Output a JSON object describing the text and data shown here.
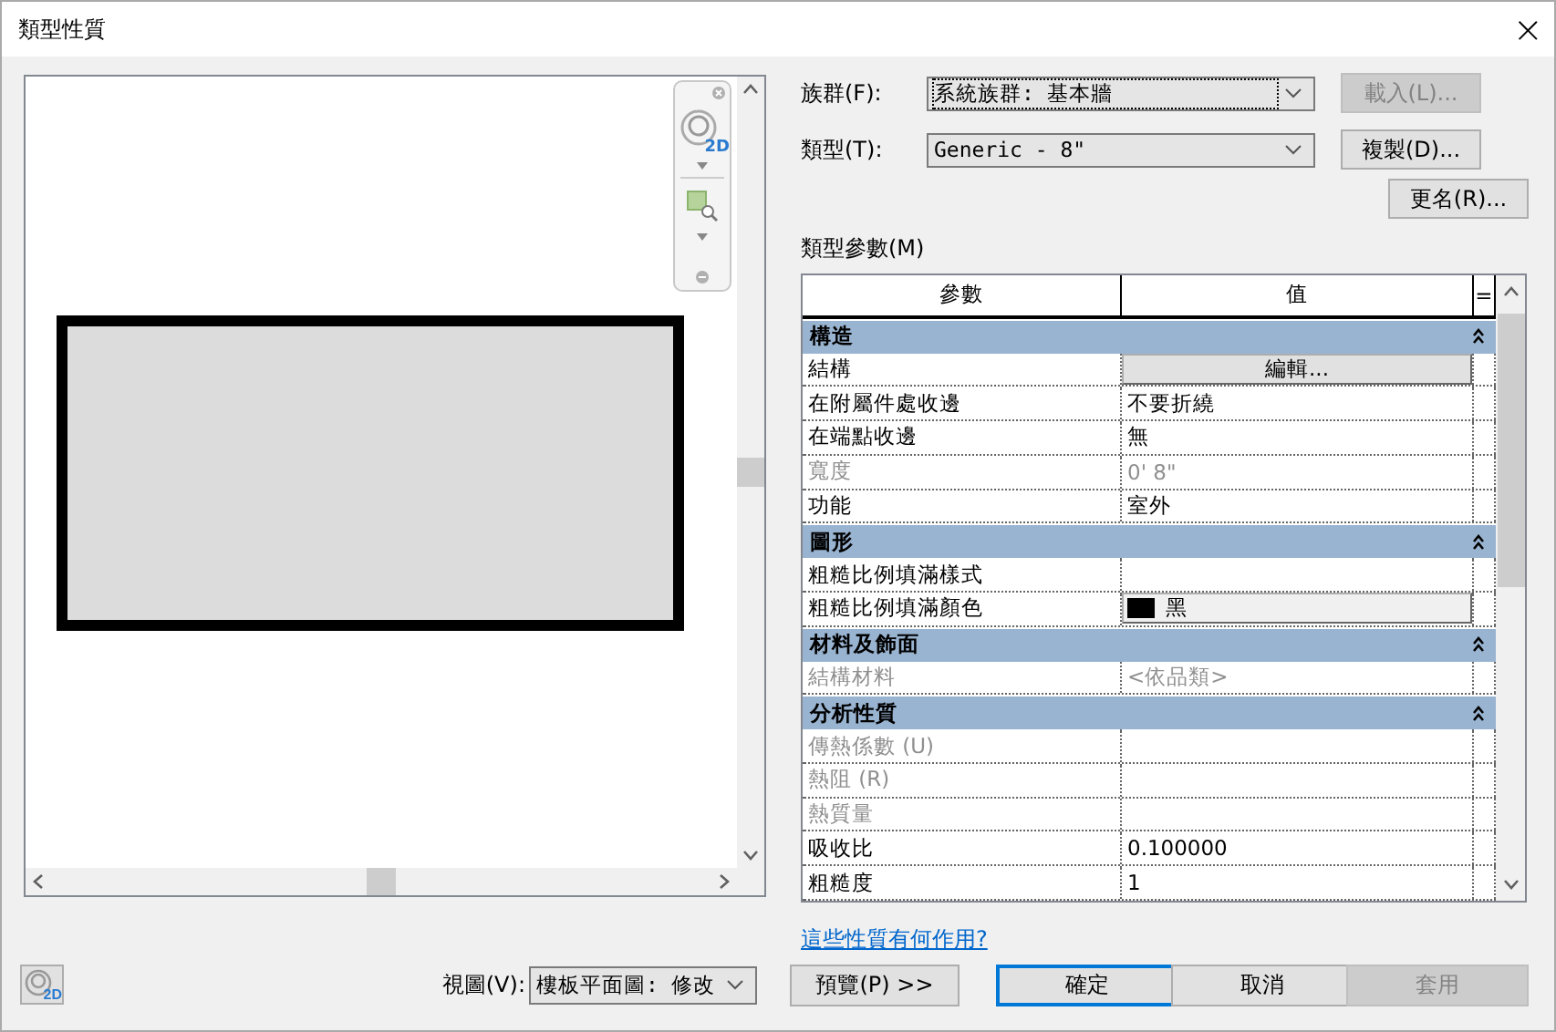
{
  "window": {
    "title": "類型性質",
    "close": "×"
  },
  "preview": {
    "nav_badge": "2D"
  },
  "family": {
    "label": "族群(F):",
    "value": "系統族群: 基本牆"
  },
  "type": {
    "label": "類型(T):",
    "value": "Generic - 8\""
  },
  "side_buttons": [
    {
      "label": "載入(L)...",
      "disabled": true
    },
    {
      "label": "複製(D)...",
      "disabled": false
    },
    {
      "label": "更名(R)...",
      "disabled": false
    }
  ],
  "params": {
    "label": "類型參數(M)",
    "columns": [
      "參數",
      "值",
      "="
    ],
    "groups": [
      {
        "name": "構造",
        "expanded": true,
        "rows": [
          {
            "name": "結構",
            "value": "編輯...",
            "kind": "button",
            "disabled": false
          },
          {
            "name": "在附屬件處收邊",
            "value": "不要折繞",
            "kind": "text",
            "disabled": false
          },
          {
            "name": "在端點收邊",
            "value": "無",
            "kind": "text",
            "disabled": false
          },
          {
            "name": "寬度",
            "value": "0' 8\"",
            "kind": "text",
            "disabled": true
          },
          {
            "name": "功能",
            "value": "室外",
            "kind": "text",
            "disabled": false
          }
        ]
      },
      {
        "name": "圖形",
        "expanded": true,
        "rows": [
          {
            "name": "粗糙比例填滿樣式",
            "kind": "text",
            "disabled": false
          },
          {
            "name": "粗糙比例填滿顏色",
            "value": "黑",
            "kind": "color",
            "color": "#000000",
            "disabled": false
          }
        ]
      },
      {
        "name": "材料及飾面",
        "expanded": true,
        "rows": [
          {
            "name": "結構材料",
            "value": "<依品類>",
            "kind": "text",
            "disabled": true
          }
        ]
      },
      {
        "name": "分析性質",
        "expanded": true,
        "rows": [
          {
            "name": "傳熱係數 (U)",
            "kind": "text",
            "disabled": true
          },
          {
            "name": "熱阻 (R)",
            "kind": "text",
            "disabled": true
          },
          {
            "name": "熱質量",
            "kind": "text",
            "disabled": true
          },
          {
            "name": "吸收比",
            "value": "0.100000",
            "kind": "text",
            "disabled": false
          },
          {
            "name": "粗糙度",
            "value": "1",
            "kind": "text",
            "disabled": false
          }
        ]
      }
    ]
  },
  "help_link": "這些性質有何作用?",
  "footer": {
    "view_badge": "2D",
    "view_label": "視圖(V):",
    "view_value": "樓板平面圖: 修改",
    "preview_button": "預覽(P) >>",
    "buttons": [
      {
        "label": "確定",
        "default": true,
        "disabled": false
      },
      {
        "label": "取消",
        "default": false,
        "disabled": false
      },
      {
        "label": "套用",
        "default": false,
        "disabled": true
      }
    ]
  }
}
